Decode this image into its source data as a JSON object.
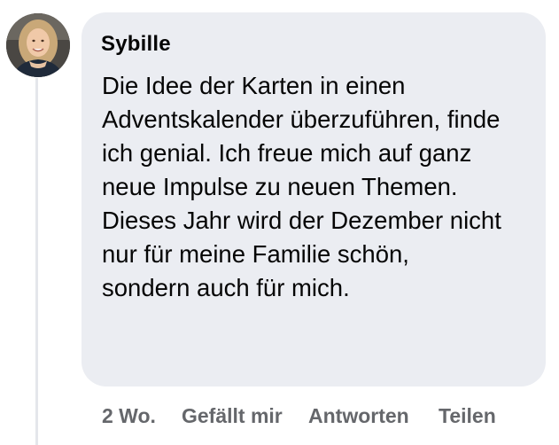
{
  "comment": {
    "author": "Sybille",
    "text_lines": [
      "Die Idee der Karten in einen",
      "Adventskalender überzuführen, finde",
      "ich genial. Ich freue mich auf ganz",
      "neue Impulse zu neuen Themen.",
      "Dieses Jahr wird der Dezember nicht",
      "nur für meine Familie schön,",
      "sondern auch für mich."
    ],
    "timestamp": "2 Wo.",
    "actions": {
      "like_label": "Gefällt mir",
      "reply_label": "Antworten",
      "share_label": "Teilen"
    }
  },
  "colors": {
    "bubble_background": "#ebedf2",
    "text": "#050505",
    "secondary_text": "#65676b",
    "thread_line": "#e4e6eb"
  }
}
